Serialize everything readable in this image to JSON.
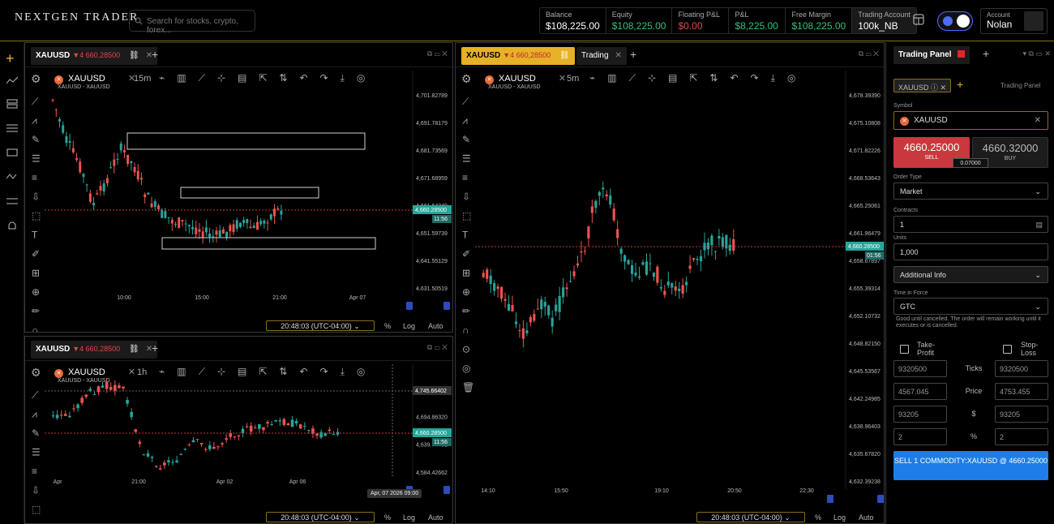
{
  "app": {
    "logo_text": "NEXTGEN TRADER"
  },
  "search": {
    "placeholder": "Search for stocks, crypto, forex..."
  },
  "stats": [
    {
      "label": "Balance",
      "value": "$108,225.00",
      "color": "#ffffff"
    },
    {
      "label": "Equity",
      "value": "$108,225.00",
      "color": "#2ec27e"
    },
    {
      "label": "Floating P&L",
      "value": "$0.00",
      "color": "#e04848"
    },
    {
      "label": "P&L",
      "value": "$8,225.00",
      "color": "#2ec27e"
    },
    {
      "label": "Free Margin",
      "value": "$108,225.00",
      "color": "#2ec27e"
    },
    {
      "label": "Trading Account",
      "value": "100k_NB",
      "color": "#ffffff"
    }
  ],
  "account": {
    "label": "Account",
    "name": "Nolan"
  },
  "colors": {
    "up": "#26a69a",
    "down": "#ef5350",
    "accent": "#e6b126",
    "buy_blue": "#1e7de6"
  },
  "icons_left": [
    "plus-icon",
    "trend-line-icon",
    "layers-icon",
    "list-icon",
    "monitor-icon",
    "transfer-icon",
    "swap-icon",
    "bell-icon"
  ],
  "charts": {
    "c1": {
      "tab_symbol": "XAUUSD",
      "tab_change": "▼4 660,28500",
      "symbol": "XAUUSD",
      "interval": "15m",
      "legend": "XAUUSD - XAUUSD",
      "price_label": "4,660.28500",
      "countdown": "11:56",
      "y_labels": [
        "4,701.82789",
        "4,691.78179",
        "4,681.73569",
        "4,671.68959",
        "4,661.64349",
        "4,651.59739",
        "4,641.55129",
        "4,631.50519"
      ],
      "x_labels": [
        "10:00",
        "15:00",
        "21:00",
        "Apr 07"
      ],
      "time": "20:48:03 (UTC-04:00)",
      "pct": "%",
      "log": "Log",
      "auto": "Auto"
    },
    "c2": {
      "tab_symbol": "XAUUSD",
      "tab_change": "▼4 660,28500",
      "symbol": "XAUUSD",
      "interval": "1h",
      "legend": "XAUUSD - XAUUSD",
      "price_label": "4,660.28500",
      "countdown": "11:56",
      "cross_price": "4,745.66402",
      "y_labels": [
        "4,759.98148",
        "4,694.86320",
        "4,639.74492",
        "4,584.42662"
      ],
      "x_labels": [
        "Apr",
        "21:00",
        "Apr 02",
        "Apr 06"
      ],
      "cross_time": "Apr, 07 2026 09:00",
      "time": "20:48:03 (UTC-04:00)",
      "pct": "%",
      "log": "Log",
      "auto": "Auto"
    },
    "c3": {
      "tab_symbol": "XAUUSD",
      "tab_change": "▼4 660,28500",
      "tab2": "Trading",
      "symbol": "XAUUSD",
      "interval": "5m",
      "legend": "XAUUSD - XAUUSD",
      "price_label": "4,660.28500",
      "countdown": "01:56",
      "y_labels": [
        "4,678.39390",
        "4,675.10808",
        "4,671.82226",
        "4,668.53643",
        "4,665.25061",
        "4,661.96479",
        "4,658.67897",
        "4,655.39314",
        "4,652.10732",
        "4,648.82150",
        "4,645.53567",
        "4,642.24985",
        "4,638.96403",
        "4,635.67820",
        "4,632.39238"
      ],
      "x_labels": [
        "14:10",
        "15:50",
        "19:10",
        "20:50",
        "22:30"
      ],
      "time": "20:48:03 (UTC-04:00)",
      "pct": "%",
      "log": "Log",
      "auto": "Auto"
    }
  },
  "trading_panel": {
    "tab": "Trading Panel",
    "symbol_chip": "XAUUSD",
    "title": "Trading Panel",
    "symbol_label": "Symbol",
    "symbol_value": "XAUUSD",
    "sell_price": "4660.25000",
    "sell_label": "SELL",
    "buy_price": "4660.32000",
    "buy_label": "BUY",
    "spread": "0.07000",
    "order_type_label": "Order Type",
    "order_type": "Market",
    "contracts_label": "Contracts",
    "contracts": "1",
    "units_label": "Units",
    "units": "1,000",
    "additional_info": "Additional Info",
    "tif_label": "Time in Force",
    "tif": "GTC",
    "tif_note": "Good until cancelled. The order will remain working until it executes or is cancelled.",
    "take_profit": "Take-Profit",
    "stop_loss": "Stop-Loss",
    "rows": [
      {
        "label": "Ticks",
        "left": "9320500",
        "right": "9320500"
      },
      {
        "label": "Price",
        "left": "4567.045",
        "right": "4753.455"
      },
      {
        "label": "$",
        "left": "93205",
        "right": "93205"
      },
      {
        "label": "%",
        "left": "2",
        "right": "2"
      }
    ],
    "submit": "SELL 1 COMMODITY:XAUUSD @ 4660.25000"
  }
}
